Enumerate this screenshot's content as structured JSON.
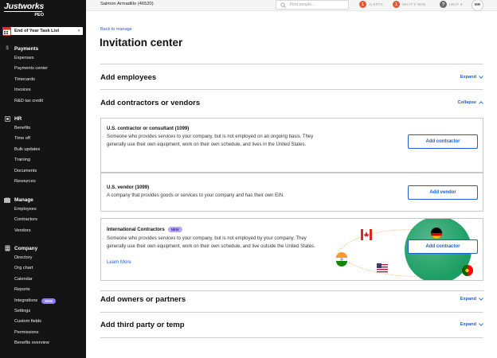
{
  "sidebar": {
    "brand": "Justworks",
    "brand_sub": "PEO",
    "tasklist_label": "End of Year Task List",
    "sections": {
      "payments": {
        "title": "Payments",
        "items": [
          "Expenses",
          "Payments center",
          "Timecards",
          "Invoices",
          "R&D tax credit"
        ]
      },
      "hr": {
        "title": "HR",
        "items": [
          "Benefits",
          "Time off",
          "Bulk updates",
          "Training",
          "Documents",
          "Resources"
        ]
      },
      "manage": {
        "title": "Manage",
        "items": [
          "Employees",
          "Contractors",
          "Vendors"
        ]
      },
      "company": {
        "title": "Company",
        "items": [
          "Directory",
          "Org chart",
          "Calendar",
          "Reports",
          "Integrations",
          "Settings",
          "Custom fields",
          "Permissions",
          "Benefits overview"
        ],
        "integrations_badge": "NEW"
      }
    }
  },
  "topbar": {
    "company_name": "Salmon Armadillo (46520)",
    "search_placeholder": "Find people...",
    "alerts_count": "1",
    "alerts_label": "ALERTS",
    "whats_new_count": "1",
    "whats_new_label": "WHAT'S NEW",
    "help_label": "HELP",
    "avatar_initials": "MR"
  },
  "main": {
    "back_link": "Back to manage",
    "title": "Invitation center",
    "sections": {
      "employees": {
        "title": "Add employees",
        "toggle": "Expand"
      },
      "contractors": {
        "title": "Add contractors or vendors",
        "toggle": "Collapse"
      },
      "owners": {
        "title": "Add owners or partners",
        "toggle": "Expand"
      },
      "third_party": {
        "title": "Add third party or temp",
        "toggle": "Expand"
      }
    },
    "cards": {
      "us_contractor": {
        "title": "U.S. contractor or consultant (1099)",
        "desc": "Someone who provides services to your company, but is not employed on an ongoing basis. They generally use their own equipment, work on their own schedule, and lives in the United States.",
        "button": "Add contractor"
      },
      "us_vendor": {
        "title": "U.S. vendor (1099)",
        "desc": "A company that provides goods or services to your company and has their own EIN.",
        "button": "Add vendor"
      },
      "international": {
        "title": "International Contractors",
        "badge": "NEW",
        "desc": "Someone who provides services to your company, but is not employed by your company. They generally use their own equipment, work on their own schedule, and live outside the United States.",
        "learn_more": "Learn More",
        "button": "Add contractor"
      }
    }
  },
  "colors": {
    "sidebar_bg": "#141414",
    "link_blue": "#1a5ed6",
    "alert_orange": "#e25a32",
    "new_badge_purple": "#8e79ff",
    "globe_green": "#1b9e63"
  }
}
